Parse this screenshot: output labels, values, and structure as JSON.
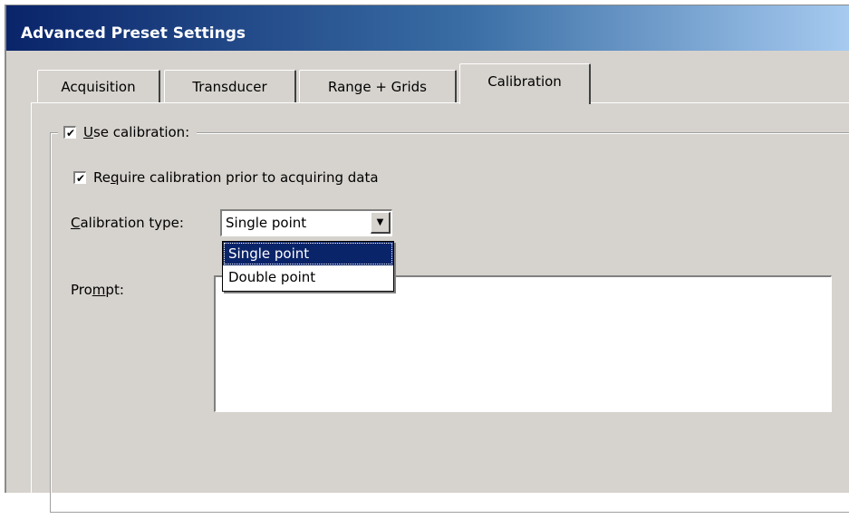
{
  "window": {
    "title": "Advanced Preset Settings"
  },
  "tabs": [
    {
      "label": "Acquisition",
      "active": false
    },
    {
      "label": "Transducer",
      "active": false
    },
    {
      "label": "Range + Grids",
      "active": false
    },
    {
      "label": "Calibration",
      "active": true
    }
  ],
  "use_calibration": {
    "label_access": "U",
    "label_rest": "se calibration:",
    "checked": true
  },
  "require_calibration": {
    "label_pre": "Re",
    "label_access": "q",
    "label_rest": "uire calibration prior to acquiring data",
    "checked": true
  },
  "calibration_type": {
    "label_access": "C",
    "label_rest": "alibration type:",
    "value": "Single point",
    "options": [
      "Single point",
      "Double point"
    ],
    "selected_index": 0
  },
  "prompt": {
    "label_pre": "Pro",
    "label_access": "m",
    "label_rest": "pt:",
    "value": ""
  },
  "colors": {
    "title_start": "#0a246a",
    "title_end": "#a6caf0",
    "face": "#d6d3ce",
    "highlight": "#0a246a"
  }
}
